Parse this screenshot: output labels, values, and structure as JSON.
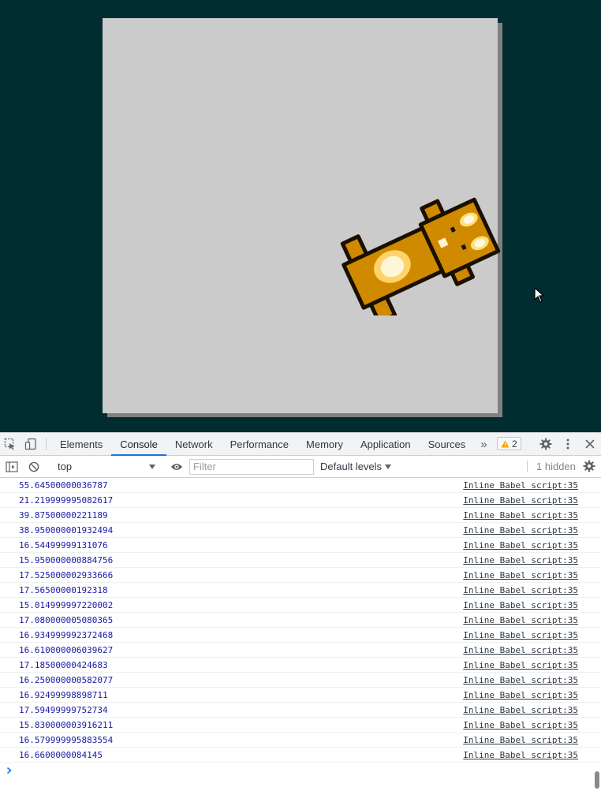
{
  "devtools": {
    "tabs": [
      {
        "label": "Elements"
      },
      {
        "label": "Console"
      },
      {
        "label": "Network"
      },
      {
        "label": "Performance"
      },
      {
        "label": "Memory"
      },
      {
        "label": "Application"
      },
      {
        "label": "Sources"
      }
    ],
    "active_tab": "Console",
    "warning_count": "2",
    "overflow_symbol": "»"
  },
  "toolbar": {
    "context": "top",
    "filter_placeholder": "Filter",
    "levels": "Default levels",
    "hidden": "1 hidden"
  },
  "console": {
    "rows": [
      {
        "value": "55.64500000036787",
        "source": "Inline Babel script:35"
      },
      {
        "value": "21.219999995082617",
        "source": "Inline Babel script:35"
      },
      {
        "value": "39.87500000221189",
        "source": "Inline Babel script:35"
      },
      {
        "value": "38.950000001932494",
        "source": "Inline Babel script:35"
      },
      {
        "value": "16.54499999131076",
        "source": "Inline Babel script:35"
      },
      {
        "value": "15.950000000884756",
        "source": "Inline Babel script:35"
      },
      {
        "value": "17.525000002933666",
        "source": "Inline Babel script:35"
      },
      {
        "value": "17.56500000192318",
        "source": "Inline Babel script:35"
      },
      {
        "value": "15.014999997220002",
        "source": "Inline Babel script:35"
      },
      {
        "value": "17.080000005080365",
        "source": "Inline Babel script:35"
      },
      {
        "value": "16.934999992372468",
        "source": "Inline Babel script:35"
      },
      {
        "value": "16.610000006039627",
        "source": "Inline Babel script:35"
      },
      {
        "value": "17.18500000424683",
        "source": "Inline Babel script:35"
      },
      {
        "value": "16.250000000582077",
        "source": "Inline Babel script:35"
      },
      {
        "value": "16.92499998898711",
        "source": "Inline Babel script:35"
      },
      {
        "value": "17.59499999752734",
        "source": "Inline Babel script:35"
      },
      {
        "value": "15.830000003916211",
        "source": "Inline Babel script:35"
      },
      {
        "value": "16.579999995883554",
        "source": "Inline Babel script:35"
      },
      {
        "value": "16.6600000084145",
        "source": "Inline Babel script:35"
      }
    ],
    "prompt_symbol": "›"
  },
  "colors": {
    "viewport_bg": "#022d30",
    "canvas_bg": "#cbcbcb",
    "sprite_body": "#d08a00",
    "log_value": "#1a1aa6",
    "active_tab_underline": "#1a73e8"
  },
  "icons": [
    "inspect-element-icon",
    "device-toolbar-icon",
    "warning-icon",
    "settings-gear-icon",
    "more-vertical-icon",
    "close-icon",
    "sidebar-toggle-icon",
    "clear-console-icon",
    "dropdown-arrow-icon",
    "eye-icon",
    "console-prompt-icon"
  ]
}
